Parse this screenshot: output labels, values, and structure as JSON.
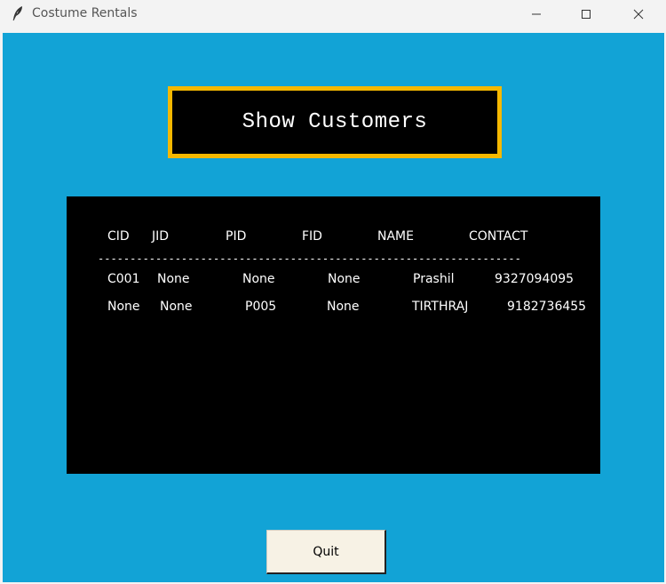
{
  "window": {
    "title": "Costume Rentals",
    "icon": "feather-icon",
    "controls": [
      "minimize-icon",
      "maximize-icon",
      "close-icon"
    ]
  },
  "heading": "Show Customers",
  "table": {
    "headers": [
      "CID",
      "JID",
      "PID",
      "FID",
      "NAME",
      "CONTACT"
    ],
    "separator": "--------------------------------------------------------------------------------------------------------------",
    "rows": [
      [
        "C001",
        "None",
        "None",
        "None",
        "Prashil",
        "9327094095"
      ],
      [
        "None",
        "None",
        "P005",
        "None",
        "TIRTHRAJ",
        "9182736455"
      ]
    ]
  },
  "quit_label": "Quit",
  "colors": {
    "background": "#12a3d6",
    "heading_border": "#f5b800",
    "panel": "#000000",
    "button": "#f7f2e5"
  }
}
